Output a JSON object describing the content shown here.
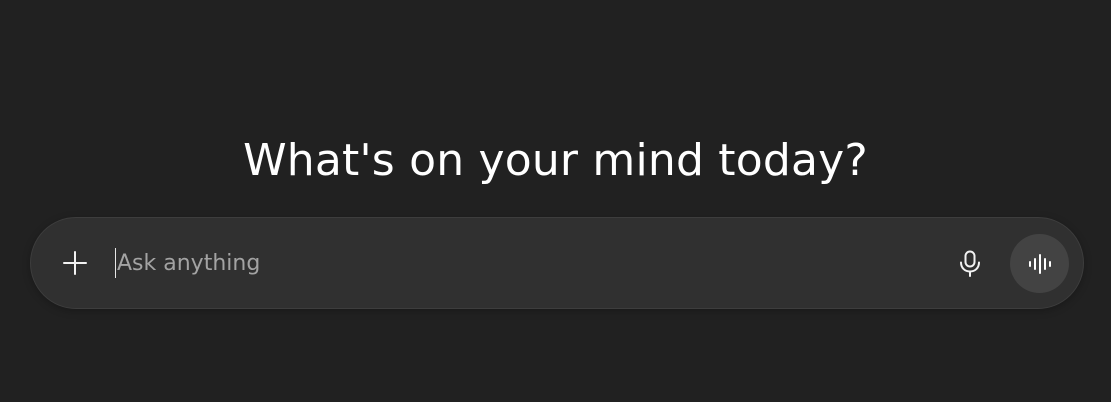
{
  "heading": {
    "text": "What's on your mind today?"
  },
  "composer": {
    "input_value": "",
    "placeholder": "Ask anything",
    "attach_icon": "plus-icon",
    "dictate_icon": "microphone-icon",
    "voice_mode_icon": "voice-waveform-icon"
  },
  "colors": {
    "background": "#212121",
    "composer_bg": "#303030",
    "voice_button_bg": "#434343",
    "text": "#ffffff",
    "placeholder": "#a3a3a3"
  }
}
